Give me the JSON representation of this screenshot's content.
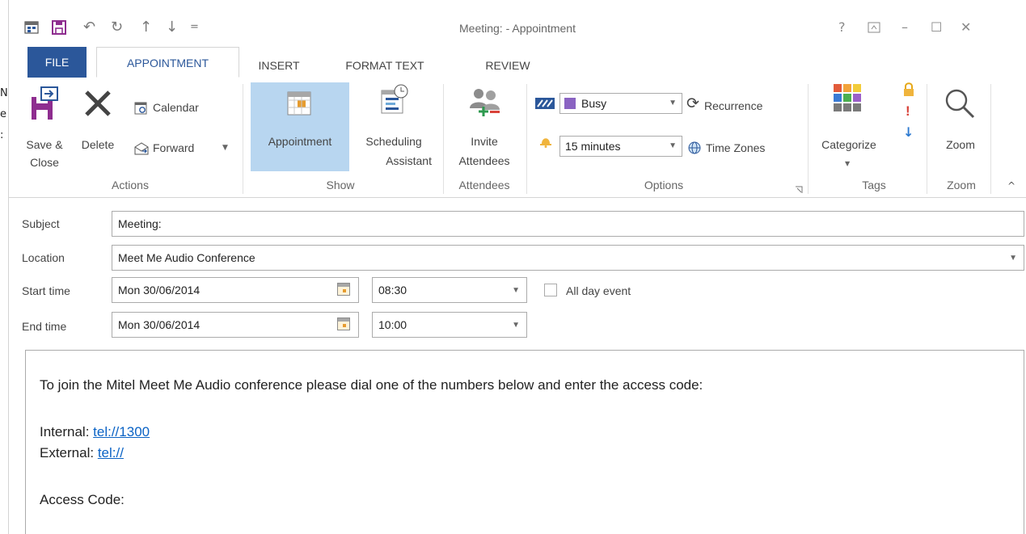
{
  "window": {
    "title": "Meeting: - Appointment",
    "help": "?",
    "minimize": "–",
    "maximize": "☐",
    "close": "✕"
  },
  "quick_access": {
    "undo": "↶",
    "redo": "↻",
    "up": "↑",
    "down": "↓",
    "customize": "="
  },
  "background_window_fragments": [
    "N",
    "e",
    ":"
  ],
  "tabs": [
    {
      "label": "FILE"
    },
    {
      "label": "APPOINTMENT"
    },
    {
      "label": "INSERT"
    },
    {
      "label": "FORMAT TEXT"
    },
    {
      "label": "REVIEW"
    }
  ],
  "ribbon": {
    "actions": {
      "group_label": "Actions",
      "save_close_line1": "Save &",
      "save_close_line2": "Close",
      "delete": "Delete",
      "calendar": "Calendar",
      "forward": "Forward"
    },
    "show": {
      "group_label": "Show",
      "appointment": "Appointment",
      "scheduling_line1": "Scheduling",
      "scheduling_line2": "Assistant"
    },
    "attendees": {
      "group_label": "Attendees",
      "invite_line1": "Invite",
      "invite_line2": "Attendees"
    },
    "options": {
      "group_label": "Options",
      "show_as": "Busy",
      "reminder": "15 minutes",
      "recurrence": "Recurrence",
      "time_zones": "Time Zones"
    },
    "tags": {
      "group_label": "Tags",
      "categorize": "Categorize"
    },
    "zoom": {
      "group_label": "Zoom",
      "zoom": "Zoom"
    }
  },
  "form": {
    "subject_label": "Subject",
    "subject_value": "Meeting:",
    "location_label": "Location",
    "location_value": "Meet Me Audio Conference",
    "start_label": "Start time",
    "start_date": "Mon 30/06/2014",
    "start_time": "08:30",
    "all_day_label": "All day event",
    "end_label": "End time",
    "end_date": "Mon 30/06/2014",
    "end_time": "10:00"
  },
  "body": {
    "intro": "To join the Mitel Meet Me Audio conference please dial one of the numbers below and enter the access code:",
    "internal_label": "Internal: ",
    "internal_link": "tel://1300",
    "external_label": "External: ",
    "external_link": "tel://",
    "access_code_label": "Access Code:"
  },
  "colors": {
    "accent": "#2b579a",
    "selected_button": "#b8d6f0",
    "link": "#0b63c5",
    "busy": "#8a63c2"
  }
}
